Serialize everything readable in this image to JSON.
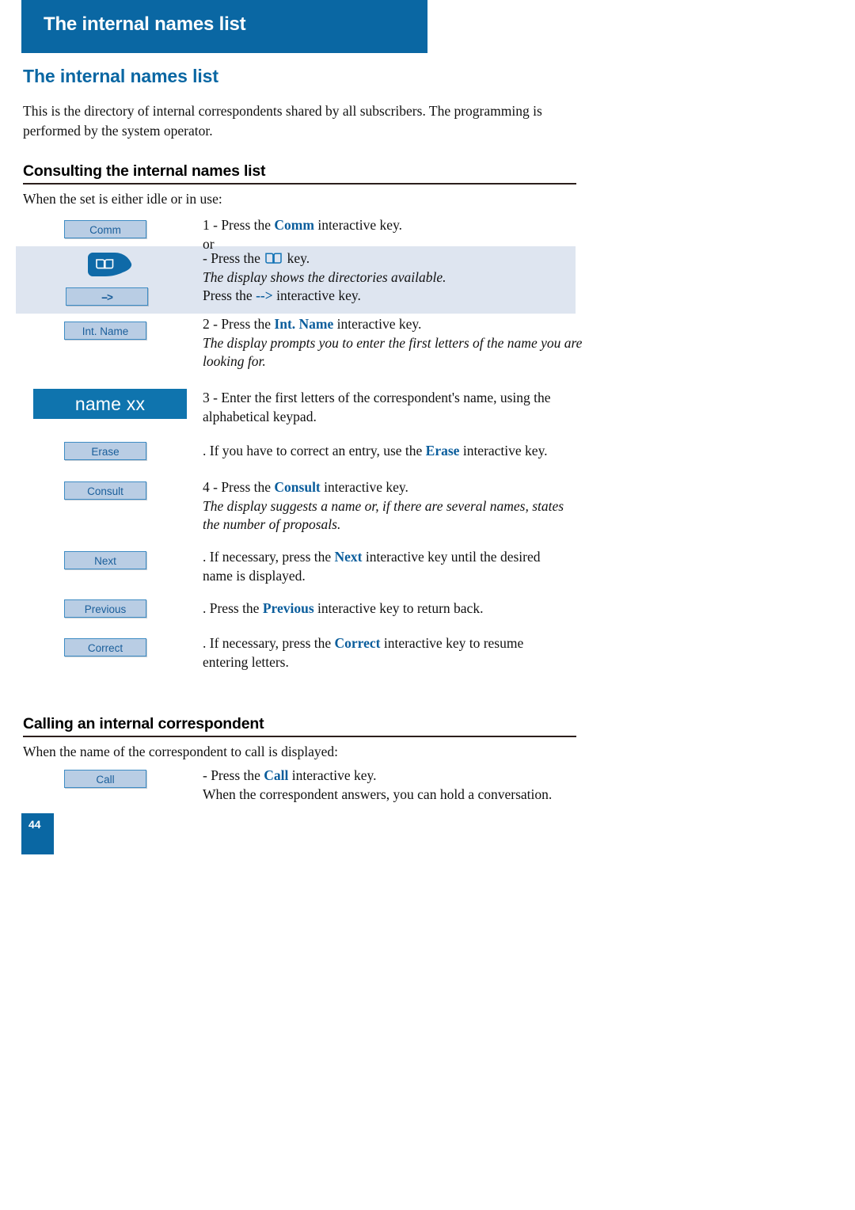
{
  "header": {
    "banner_title": "The internal names list",
    "banner_color": "#0a67a3"
  },
  "page": {
    "title": "The internal names list",
    "title_color": "#0a67a3",
    "intro": "This is the directory of internal correspondents shared by all subscribers. The programming is performed by the system operator.",
    "number": "44"
  },
  "sections": [
    {
      "heading": "Consulting the internal names list",
      "lead": "When the set is either idle or in use:"
    },
    {
      "heading": "Calling an internal correspondent",
      "lead": "When the name of the correspondent to call is displayed:"
    }
  ],
  "steps": {
    "comm": {
      "key_label": "Comm",
      "line1_pre": "1 - Press the ",
      "line1_kw": "Comm",
      "line1_post": " interactive key.",
      "line2": "or"
    },
    "book": {
      "key_icon": "book-key-icon",
      "line1_pre": "- Press the ",
      "line1_icon": "book-icon",
      "line1_post": " key.",
      "line2_italic": "The display shows the directories available.",
      "arrow_key_label": "-->",
      "line3_pre": "Press the ",
      "line3_kw": "-->",
      "line3_post": " interactive key."
    },
    "int_name": {
      "key_label": "Int. Name",
      "line1_pre": "2 - Press the ",
      "line1_kw": "Int. Name",
      "line1_post": " interactive key.",
      "line2_italic": "The display prompts you to enter the first letters of the name you are looking for."
    },
    "name_entry": {
      "display_label": "name xx",
      "line1": "3 - Enter the first letters of the correspondent's name, using the alphabetical keypad."
    },
    "erase": {
      "key_label": "Erase",
      "line1_pre": ". If you have to correct an entry, use the ",
      "line1_kw": "Erase",
      "line1_post": " interactive key."
    },
    "consult": {
      "key_label": "Consult",
      "line1_pre": "4 - Press the ",
      "line1_kw": "Consult",
      "line1_post": " interactive key.",
      "line2_italic": "The display suggests a name or, if there are several names, states the number of proposals."
    },
    "next": {
      "key_label": "Next",
      "line1_pre": ". If necessary, press the ",
      "line1_kw": "Next",
      "line1_post": " interactive key until the desired name is displayed."
    },
    "previous": {
      "key_label": "Previous",
      "line1_pre": ". Press the ",
      "line1_kw": "Previous",
      "line1_post": " interactive key to return back."
    },
    "correct": {
      "key_label": "Correct",
      "line1_pre": ". If necessary, press the ",
      "line1_kw": "Correct",
      "line1_post": " interactive key to resume entering letters."
    },
    "call": {
      "key_label": "Call",
      "line1_pre": "- Press the ",
      "line1_kw": "Call",
      "line1_post": " interactive key.",
      "line2": "When the correspondent answers, you can hold a conversation."
    }
  },
  "colors": {
    "brand_blue": "#0a67a3",
    "key_fill": "#b9cde4",
    "key_border": "#3e8cc4",
    "key_text": "#1a5e9a",
    "band_bg": "#dee5f0",
    "display_fill": "#0f74ae"
  }
}
